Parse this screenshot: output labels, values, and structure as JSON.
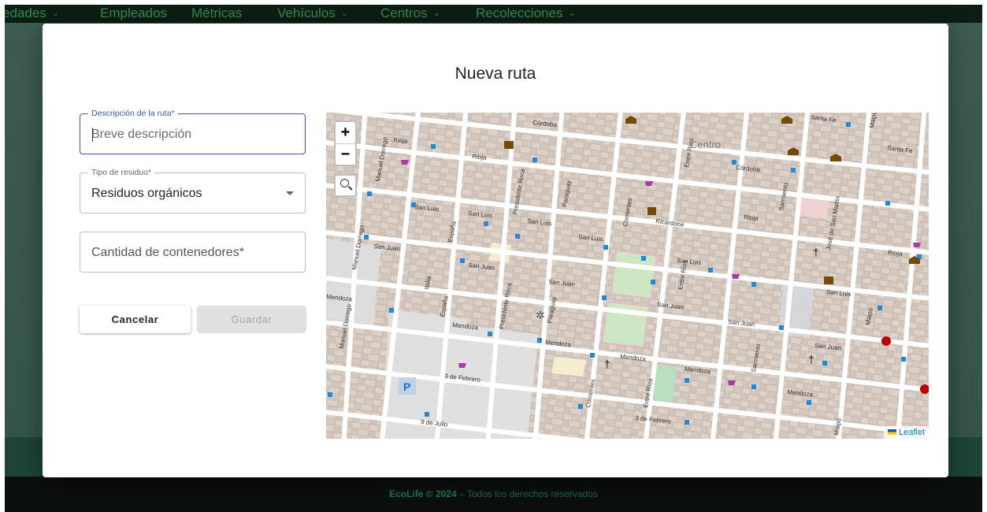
{
  "nav": {
    "items": [
      {
        "label": "edades",
        "has_menu": true
      },
      {
        "label": "Empleados",
        "has_menu": false
      },
      {
        "label": "Métricas",
        "has_menu": false
      },
      {
        "label": "Vehículos",
        "has_menu": true
      },
      {
        "label": "Centros",
        "has_menu": true
      },
      {
        "label": "Recolecciones",
        "has_menu": true
      }
    ],
    "chevron": "⌄"
  },
  "modal": {
    "title": "Nueva ruta",
    "form": {
      "description": {
        "label": "Descripción de la ruta*",
        "value": "",
        "placeholder": "Breve descripción"
      },
      "waste_type": {
        "label": "Tipo de residuo*",
        "value": "Residuos orgánicos"
      },
      "containers": {
        "label": "Cantidad de contenedores*",
        "value": ""
      }
    },
    "buttons": {
      "cancel": "Cancelar",
      "save": "Guardar"
    },
    "map": {
      "zoom_in": "+",
      "zoom_out": "−",
      "attribution": "Leaflet",
      "street_labels": {
        "cordoba_1": "Córdoba",
        "cordoba_2": "Córdoba",
        "santa_fe_1": "Santa Fe",
        "santa_fe_2": "Santa Fe",
        "rioja_1": "Rioja",
        "rioja_2": "Rioja",
        "rioja_3": "Rioja",
        "rioja_4": "Rioja",
        "san_luis_1": "San Luis",
        "san_luis_2": "San Luis",
        "san_luis_3": "San Luis",
        "san_luis_4": "San Luis",
        "san_luis_5": "San Luis",
        "san_luis_6": "San Luis",
        "san_juan_1": "San Juan",
        "san_juan_2": "San Juan",
        "san_juan_3": "San Juan",
        "san_juan_4": "San Juan",
        "san_juan_5": "San Juan",
        "san_juan_6": "San Juan",
        "mendoza_1": "Mendoza",
        "mendoza_2": "Mendoza",
        "mendoza_3": "Mendoza",
        "mendoza_4": "Mendoza",
        "mendoza_5": "Mendoza",
        "mendoza_6": "Mendoza",
        "tres_febrero_1": "3 de Febrero",
        "tres_febrero_2": "3 de Febrero",
        "nueve_julio": "9 de Julio",
        "manuel_dorrego_1": "Manuel Dorrego",
        "manuel_dorrego_2": "Manuel Dorrego",
        "manuel_dorrego_3": "Manuel Dorrego",
        "italia": "Italia",
        "espana_1": "España",
        "espana_2": "España",
        "presidente_roca_1": "Presidente Roca",
        "presidente_roca_2": "Presidente Roca",
        "paraguay_1": "Paraguay",
        "paraguay_2": "Paraguay",
        "corrientes_1": "Corrientes",
        "corrientes_2": "Corrientes",
        "entre_rios_1": "Entre Ríos",
        "entre_rios_2": "Entre Ríos",
        "entre_rios_3": "Entre Ríos",
        "sarmiento_1": "Sarmiento",
        "sarmiento_2": "Sarmiento",
        "jose_san_martin": "José de San Martín",
        "maipu_1": "Maipú",
        "maipu_2": "Maipú",
        "maipu_3": "Maipú",
        "ricardone": "Ricardone",
        "centro": "Centro",
        "parking": "P"
      }
    }
  },
  "footer": {
    "brand": "EcoLife © 2024",
    "text": " – Todos los derechos reservados"
  },
  "colors": {
    "nav_bg": "#0d1d14",
    "nav_text": "#2f8a54",
    "focus": "#3f51b5",
    "map_street": "#ffffff",
    "map_block": "#d9cfc7"
  }
}
